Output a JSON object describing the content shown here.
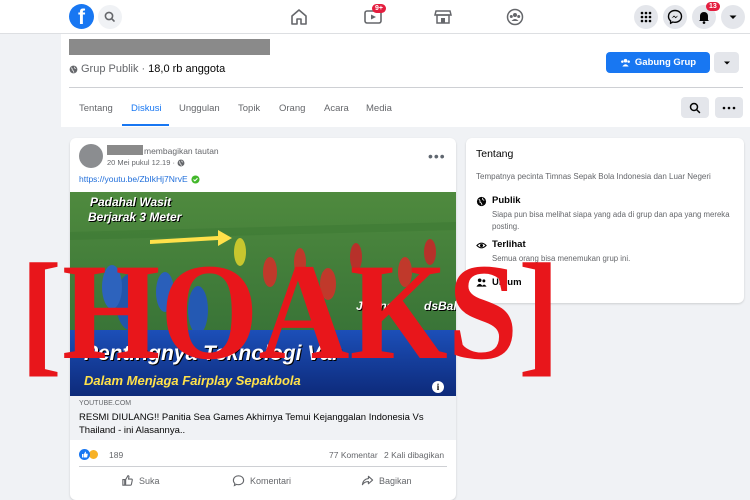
{
  "nav": {
    "logo": "f",
    "video_badge": "9+",
    "notif_badge": "13"
  },
  "group": {
    "privacy": "Grup Publik",
    "members": "18,0 rb anggota",
    "join_label": "Gabung Grup"
  },
  "tabs": [
    "Tentang",
    "Diskusi",
    "Unggulan",
    "Topik",
    "Orang",
    "Acara",
    "Media"
  ],
  "post": {
    "shared_text": "membagikan tautan",
    "date": "20 Mei pukul 12.19 ·",
    "link": "https://youtu.be/ZbIkHj7NrvE",
    "thumb_caption1": "Padahal Wasit",
    "thumb_caption2": "Berjarak 3 Meter",
    "thumb_jelang": "Jelang",
    "thumb_channel": "dsBali",
    "thumb_big1": "Pentingnya Teknologi Var",
    "thumb_big2": "Dalam Menjaga Fairplay Sepakbola",
    "preview_domain": "YOUTUBE.COM",
    "preview_title": "RESMI DIULANG!! Panitia Sea Games Akhirnya Temui Kejanggalan Indonesia Vs Thailand - ini Alasannya..",
    "reaction_count": "189",
    "comments": "77 Komentar",
    "shares": "2 Kali dibagikan",
    "like_label": "Suka",
    "comment_label": "Komentari",
    "share_label": "Bagikan"
  },
  "about": {
    "title": "Tentang",
    "description": "Tempatnya pecinta Timnas Sepak Bola Indonesia dan Luar Negeri",
    "public_title": "Publik",
    "public_desc": "Siapa pun bisa melihat siapa yang ada di grup dan apa yang mereka posting.",
    "visible_title": "Terlihat",
    "visible_desc": "Semua orang bisa menemukan grup ini.",
    "general_title": "Umum"
  },
  "stamp": {
    "text": "[HOAKS]",
    "color": "#e8161b"
  },
  "colors": {
    "brand": "#1877f2",
    "badge": "#e41e3f"
  }
}
